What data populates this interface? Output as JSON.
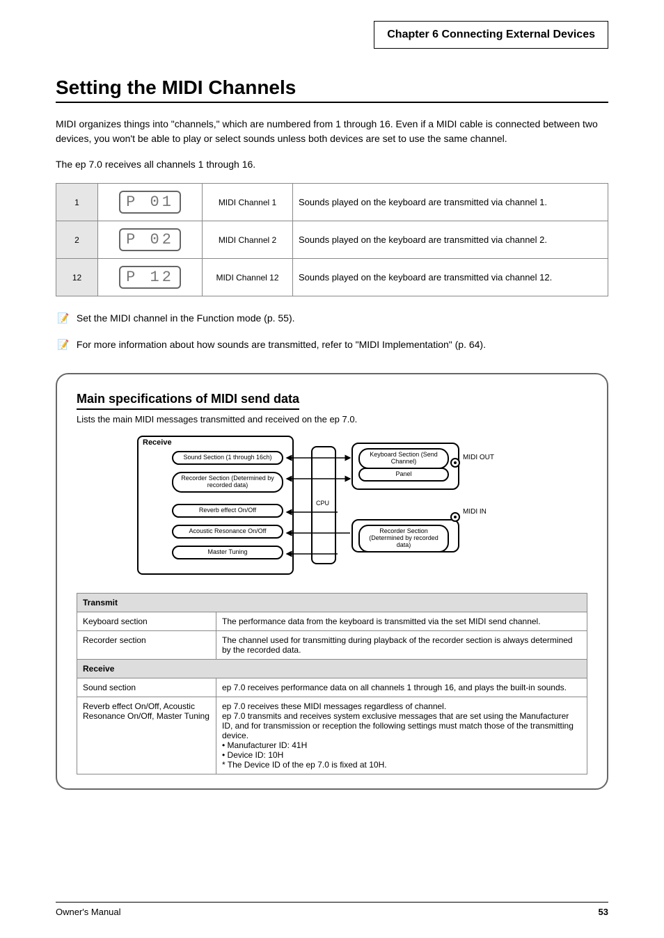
{
  "chapter_header": "Chapter 6  Connecting External Devices",
  "heading": "Setting the MIDI Channels",
  "para1": "MIDI organizes things into \"channels,\" which are numbered from 1 through 16. Even if a MIDI cable is connected between two devices, you won't be able to play or select sounds unless both devices are set to use the same channel.",
  "para2": "The ep 7.0 receives all channels 1 through 16.",
  "ch_table": {
    "rows": [
      {
        "n": "1",
        "lcd": "P 01",
        "ch": "MIDI Channel 1",
        "desc": "Sounds played on the keyboard are transmitted via channel 1."
      },
      {
        "n": "2",
        "lcd": "P 02",
        "ch": "MIDI Channel 2",
        "desc": "Sounds played on the keyboard are transmitted via channel 2."
      },
      {
        "n": "12",
        "lcd": "P 12",
        "ch": "MIDI Channel 12",
        "desc": "Sounds played on the keyboard are transmitted via channel 12."
      }
    ]
  },
  "note1": "Set the MIDI channel in the Function mode (p. 55).",
  "note2": "For more information about how sounds are transmitted, refer to \"MIDI Implementation\" (p. 64).",
  "note_icon": "📝",
  "dataflow": {
    "title": "Main specifications of MIDI send data",
    "subtitle": "Lists the main MIDI messages transmitted and received on the ep 7.0.",
    "blocks": {
      "rcv_title": "Receive",
      "rcv1": "Sound Section\n(1 through 16ch)",
      "rcv2": "Recorder Section\n(Determined by recorded data)",
      "rcv3": "Reverb effect\nOn/Off",
      "rcv4": "Acoustic Resonance\nOn/Off",
      "rcv5": "Master Tuning",
      "cpu": "CPU",
      "send1": "Keyboard Section (Send Channel)",
      "send2": "Panel",
      "send3": "Recorder Section\n(Determined by recorded data)",
      "midi_out": "MIDI OUT",
      "midi_in": "MIDI IN"
    },
    "table": {
      "tx_head": "Transmit",
      "rx_head": "Receive",
      "tx": [
        {
          "l": "Keyboard section",
          "r": "The performance data from the keyboard is transmitted via the set MIDI send channel."
        },
        {
          "l": "Recorder section",
          "r": "The channel used for transmitting during playback of the recorder section is always determined by the recorded data."
        }
      ],
      "rx": [
        {
          "l": "Sound section",
          "r": "ep 7.0 receives performance data on all channels 1 through 16, and plays the built-in sounds."
        },
        {
          "l": "Reverb effect On/Off, Acoustic Resonance On/Off, Master Tuning",
          "r": "ep 7.0 receives these MIDI messages regardless of channel.\nep 7.0 transmits and receives system exclusive messages that are set using the Manufacturer ID, and for transmission or reception the following settings must match those of the transmitting device.\n• Manufacturer ID: 41H\n• Device ID: 10H\n* The Device ID of the ep 7.0 is fixed at 10H."
        }
      ]
    }
  },
  "footer_left": "Owner's Manual",
  "footer_right": "53"
}
